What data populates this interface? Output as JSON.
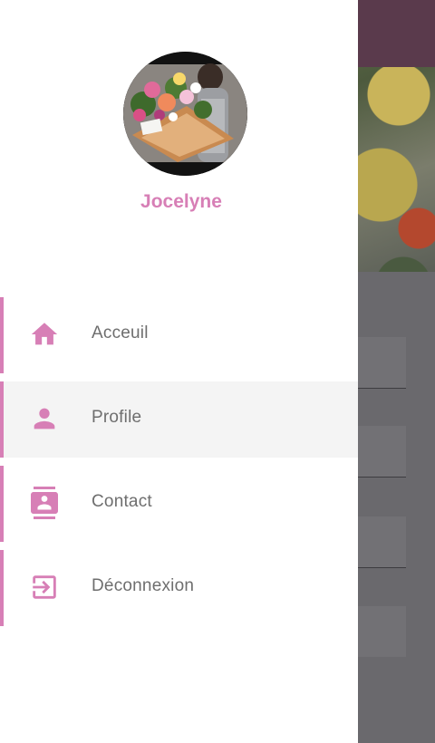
{
  "user": {
    "name": "Jocelyne"
  },
  "menu": {
    "items": [
      {
        "label": "Acceuil",
        "icon": "home-icon",
        "active": false
      },
      {
        "label": "Profile",
        "icon": "person-icon",
        "active": true
      },
      {
        "label": "Contact",
        "icon": "contact-card-icon",
        "active": false
      },
      {
        "label": "Déconnexion",
        "icon": "logout-icon",
        "active": false
      }
    ]
  },
  "colors": {
    "accent": "#d77fb6",
    "menu_text": "#6e6e6e",
    "active_bg": "#f4f4f4",
    "app_bar": "#5a3a4c"
  }
}
